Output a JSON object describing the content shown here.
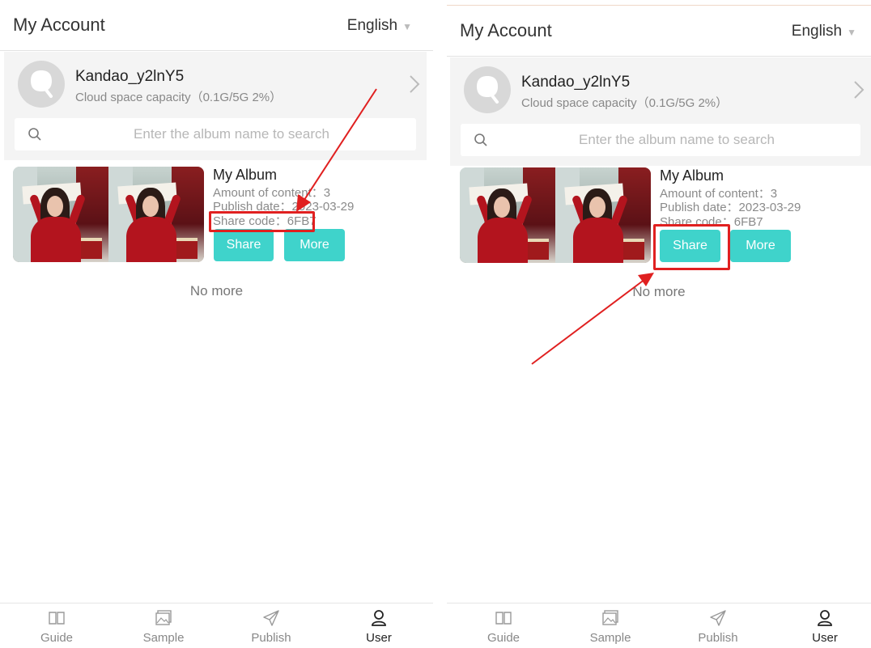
{
  "header": {
    "title": "My Account",
    "language": "English"
  },
  "profile": {
    "username": "Kandao_y2lnY5",
    "capacity": "Cloud space capacity（0.1G/5G 2%）"
  },
  "search": {
    "placeholder": "Enter the album name to search"
  },
  "album": {
    "title": "My Album",
    "content_count": "Amount of content：3",
    "publish_date": "Publish date：2023-03-29",
    "share_code": "Share code：6FB7",
    "share_label": "Share",
    "more_label": "More"
  },
  "list_end": "No more",
  "tabs": [
    {
      "label": "Guide",
      "icon": "book-icon"
    },
    {
      "label": "Sample",
      "icon": "image-icon"
    },
    {
      "label": "Publish",
      "icon": "send-icon"
    },
    {
      "label": "User",
      "icon": "user-icon",
      "active": true
    }
  ],
  "annotations": {
    "highlight_color": "#e02020",
    "left_highlight": "share-code",
    "right_highlight": "share-button"
  },
  "accent_color": "#3fd3cb"
}
